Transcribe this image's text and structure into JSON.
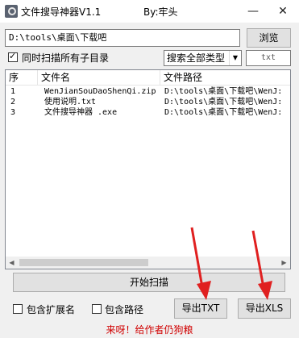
{
  "window": {
    "title": "文件搜导神器V1.1",
    "author": "By:牢头",
    "min_symbol": "—",
    "close_symbol": "✕"
  },
  "path": {
    "value": "D:\\tools\\桌面\\下载吧"
  },
  "browse_label": "浏览",
  "subdir": {
    "label": "同时扫描所有子目录",
    "checked": true
  },
  "type_select": {
    "value": "搜索全部类型"
  },
  "ext_input": {
    "value": "txt"
  },
  "table": {
    "headers": [
      "序",
      "文件名",
      "文件路径"
    ],
    "rows": [
      [
        "1",
        "WenJianSouDaoShenQi.zip",
        "D:\\tools\\桌面\\下载吧\\WenJ:"
      ],
      [
        "2",
        "使用说明.txt",
        "D:\\tools\\桌面\\下载吧\\WenJ:"
      ],
      [
        "3",
        "文件搜导神器 .exe",
        "D:\\tools\\桌面\\下载吧\\WenJ:"
      ]
    ]
  },
  "scan_label": "开始扫描",
  "include_ext": {
    "label": "包含扩展名"
  },
  "include_path": {
    "label": "包含路径"
  },
  "export_txt_label": "导出TXT",
  "export_xls_label": "导出XLS",
  "status_text": "来呀！给作者仍狗粮",
  "colors": {
    "status": "#d00000",
    "annotation_arrow": "#e02020"
  }
}
